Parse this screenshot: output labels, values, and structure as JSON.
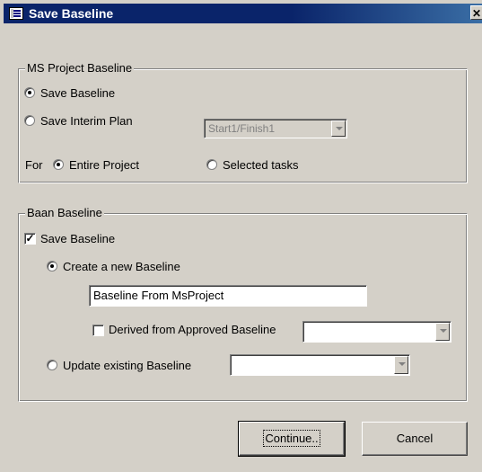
{
  "window": {
    "title": "Save Baseline",
    "close_glyph": "✕"
  },
  "ms_project_group": {
    "legend": "MS Project Baseline",
    "save_baseline_label": "Save Baseline",
    "save_baseline_selected": true,
    "save_interim_label": "Save Interim Plan",
    "interim_select_value": "Start1/Finish1",
    "for_label": "For",
    "entire_project_label": "Entire Project",
    "entire_project_selected": true,
    "selected_tasks_label": "Selected tasks"
  },
  "baan_group": {
    "legend": "Baan Baseline",
    "save_baseline_label": "Save Baseline",
    "save_baseline_checked": true,
    "check_glyph": "✓",
    "create_new_label": "Create a new Baseline",
    "create_new_selected": true,
    "new_baseline_name": "Baseline From MsProject",
    "derived_label": "Derived from Approved Baseline",
    "derived_checked": false,
    "derived_select_value": "",
    "update_existing_label": "Update existing Baseline",
    "update_existing_select_value": ""
  },
  "buttons": {
    "continue_label": "Continue..",
    "cancel_label": "Cancel"
  }
}
